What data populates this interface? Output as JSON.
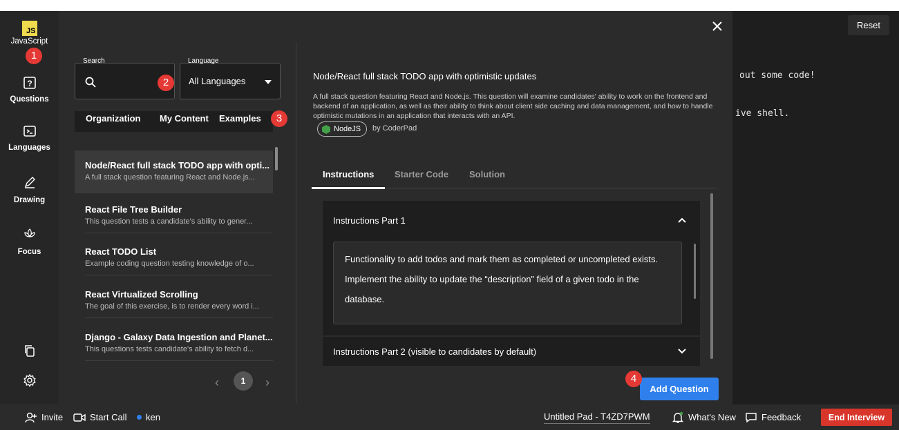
{
  "rail": {
    "language_label": "JavaScript",
    "js_badge": "JS",
    "items": [
      {
        "label": "Questions",
        "icon": "question-box-icon"
      },
      {
        "label": "Languages",
        "icon": "terminal-icon"
      },
      {
        "label": "Drawing",
        "icon": "pen-icon"
      },
      {
        "label": "Focus",
        "icon": "lotus-icon"
      }
    ],
    "bottom_icons": [
      "copy-icon",
      "gear-icon"
    ]
  },
  "modal": {
    "search_label": "Search",
    "search_placeholder": "",
    "language_label": "Language",
    "language_value": "All Languages",
    "tabs": [
      "Organization",
      "My Content",
      "Examples"
    ],
    "active_tab": "Examples",
    "questions": [
      {
        "title": "Node/React full stack TODO app with opti...",
        "desc": "A full stack question featuring React and Node.js..."
      },
      {
        "title": "React File Tree Builder",
        "desc": "This question tests a candidate's ability to gener..."
      },
      {
        "title": "React TODO List",
        "desc": "Example coding question testing knowledge of o..."
      },
      {
        "title": "React Virtualized Scrolling",
        "desc": "The goal of this exercise, is to render every word i..."
      },
      {
        "title": "Django - Galaxy Data Ingestion and Planet...",
        "desc": "This questions tests candidate's ability to fetch d..."
      }
    ],
    "pagination": {
      "prev": "‹",
      "page": "1",
      "next": "›"
    },
    "detail": {
      "title": "Node/React full stack TODO app with optimistic updates",
      "description": "A full stack question featuring React and Node.js. This question will examine candidates' ability to work on the frontend and backend of an application, as well as their ability to think about client side caching and data management, and how to handle optimistic mutations in an application that interacts with an API.",
      "language_tag": "NodeJS",
      "author": "by CoderPad",
      "tabs": [
        "Instructions",
        "Starter Code",
        "Solution"
      ],
      "active_tab": "Instructions",
      "part1_title": "Instructions Part 1",
      "part1_text_1": "Functionality to add todos and mark them as completed or uncompleted exists.",
      "part1_text_2": "Implement the ability to update the “description” field of a given todo in the",
      "part1_text_3": "database.",
      "part2_title": "Instructions Part 2 (visible to candidates by default)",
      "add_button": "Add Question"
    },
    "badges": [
      "1",
      "2",
      "3",
      "4"
    ]
  },
  "editor": {
    "reset": "Reset",
    "line1": "out some code!",
    "line2": "ive shell."
  },
  "bottombar": {
    "invite": "Invite",
    "start_call": "Start Call",
    "user": "ken",
    "pad_title": "Untitled Pad - T4ZD7PWM",
    "whats_new": "What's New",
    "feedback": "Feedback",
    "end_interview": "End Interview"
  },
  "colors": {
    "accent_blue": "#2f80ed",
    "badge_red": "#e53935",
    "end_red": "#d9362b",
    "js_yellow": "#f0db4f",
    "node_green": "#43a047"
  }
}
